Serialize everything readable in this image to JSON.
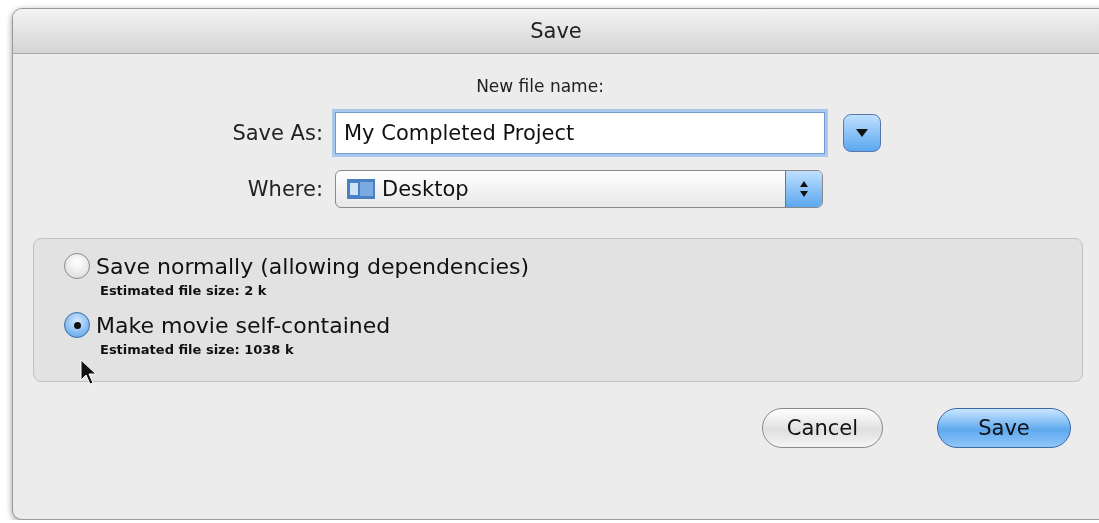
{
  "window": {
    "title": "Save"
  },
  "prompt": "New file name:",
  "save_as": {
    "label": "Save As:",
    "value": "My Completed Project"
  },
  "where": {
    "label": "Where:",
    "value": "Desktop"
  },
  "options": [
    {
      "label": "Save normally (allowing dependencies)",
      "detail": "Estimated file size: 2 k",
      "selected": false
    },
    {
      "label": "Make movie self-contained",
      "detail": "Estimated file size: 1038 k",
      "selected": true
    }
  ],
  "buttons": [
    {
      "label": "Cancel",
      "kind": "normal"
    },
    {
      "label": "Save",
      "kind": "default"
    }
  ]
}
